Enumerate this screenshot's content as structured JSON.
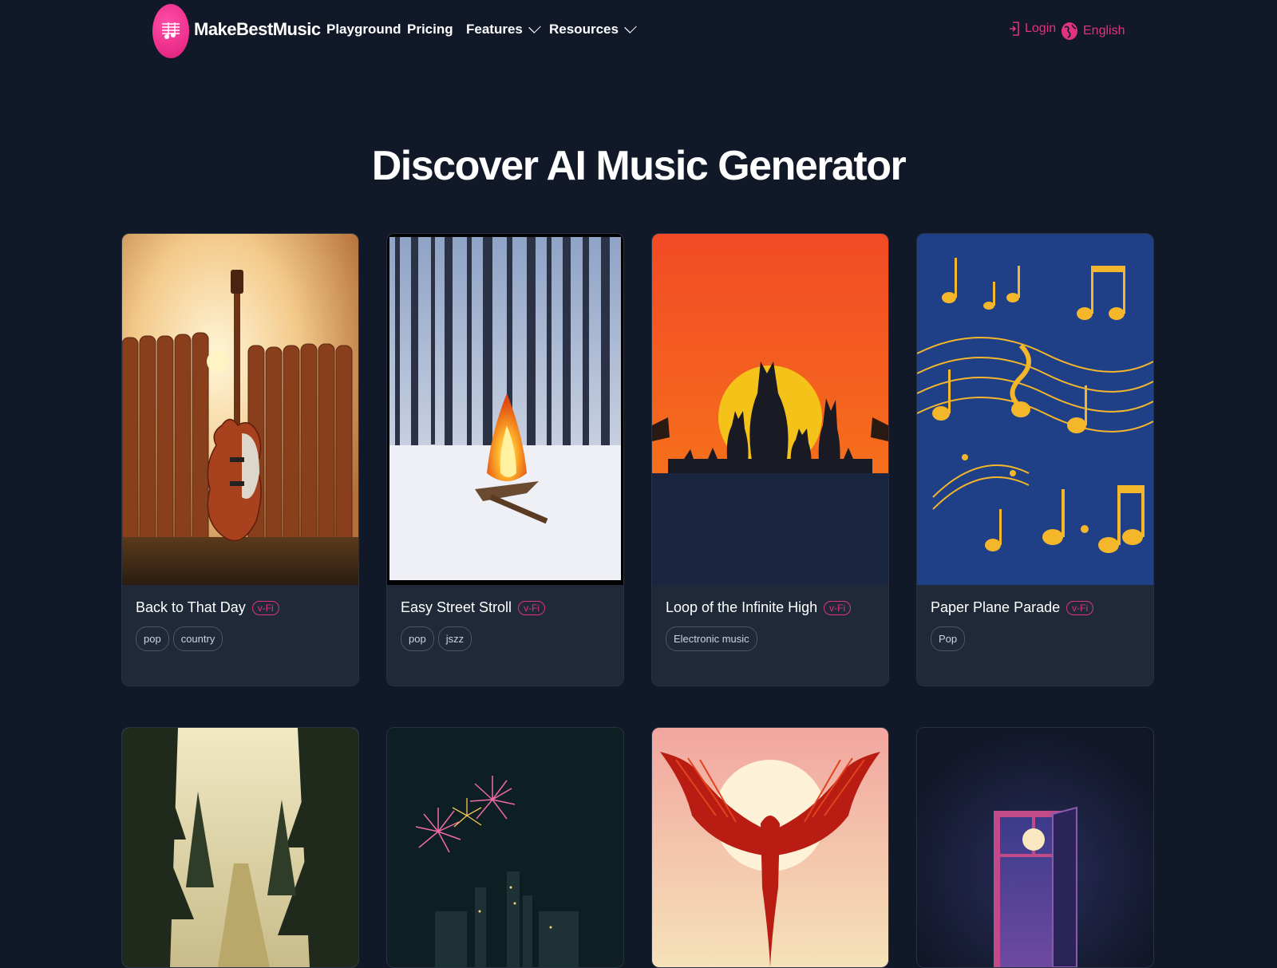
{
  "brand": {
    "name": "MakeBestMusic",
    "logo_icon": "music-note-logo"
  },
  "nav": {
    "links": [
      {
        "label": "Playground"
      },
      {
        "label": "Pricing"
      },
      {
        "label": "Features"
      },
      {
        "label": "Resources"
      }
    ],
    "login": "Login",
    "language": "English"
  },
  "heading": "Discover AI Music Generator",
  "badge_label": "v-Fi",
  "colors": {
    "background": "#111827",
    "card": "#1f2937",
    "accent": "#e0337f"
  },
  "cards": [
    {
      "title": "Back to That Day",
      "tags": [
        "pop",
        "country"
      ],
      "art": "guitar-against-fence-sunset"
    },
    {
      "title": "Easy Street Stroll",
      "tags": [
        "pop",
        "jszz"
      ],
      "art": "campfire-in-snowy-forest"
    },
    {
      "title": "Loop of the Infinite High",
      "tags": [
        "Electronic music"
      ],
      "art": "animal-silhouettes-sunset"
    },
    {
      "title": "Paper Plane Parade",
      "tags": [
        "Pop"
      ],
      "art": "golden-music-notes-blue"
    },
    {
      "title": "",
      "tags": [],
      "art": "misty-forest-road"
    },
    {
      "title": "",
      "tags": [],
      "art": "fireworks-over-city"
    },
    {
      "title": "",
      "tags": [],
      "art": "red-phoenix-sun"
    },
    {
      "title": "",
      "tags": [],
      "art": "night-window-moon"
    }
  ]
}
